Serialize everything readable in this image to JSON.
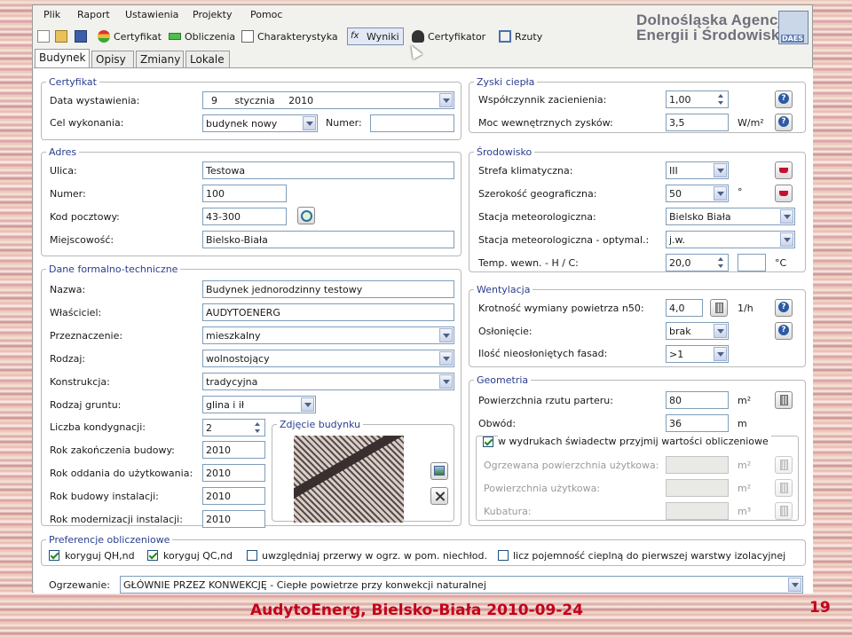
{
  "menu": [
    "Plik",
    "Raport",
    "Ustawienia",
    "Projekty",
    "Pomoc"
  ],
  "toolbar": {
    "certyfikat": "Certyfikat",
    "obliczenia": "Obliczenia",
    "charakterystyka": "Charakterystyka",
    "wyniki": "Wyniki",
    "certyfikator": "Certyfikator",
    "rzuty": "Rzuty"
  },
  "logo": {
    "line1": "Dolnośląska Agencja",
    "line2": "Energii i Środowiska",
    "mark": "DAES"
  },
  "tabs": [
    "Budynek",
    "Opisy",
    "Zmiany",
    "Lokale"
  ],
  "certyfikat": {
    "legend": "Certyfikat",
    "data_label": "Data wystawienia:",
    "data_day": "9",
    "data_month": "stycznia",
    "data_year": "2010",
    "cel_label": "Cel wykonania:",
    "cel_value": "budynek nowy",
    "numer_label": "Numer:",
    "numer_value": ""
  },
  "adres": {
    "legend": "Adres",
    "ulica_label": "Ulica:",
    "ulica": "Testowa",
    "numer_label": "Numer:",
    "numer": "100",
    "kod_label": "Kod pocztowy:",
    "kod": "43-300",
    "miejscowosc_label": "Miejscowość:",
    "miejscowosc": "Bielsko-Biała"
  },
  "dane": {
    "legend": "Dane formalno-techniczne",
    "nazwa_label": "Nazwa:",
    "nazwa": "Budynek jednorodzinny testowy",
    "wlasciciel_label": "Właściciel:",
    "wlasciciel": "AUDYTOENERG",
    "przeznaczenie_label": "Przeznaczenie:",
    "przeznaczenie": "mieszkalny",
    "rodzaj_label": "Rodzaj:",
    "rodzaj": "wolnostojący",
    "konstrukcja_label": "Konstrukcja:",
    "konstrukcja": "tradycyjna",
    "grunt_label": "Rodzaj gruntu:",
    "grunt": "glina i ił",
    "kondygnacje_label": "Liczba kondygnacji:",
    "kondygnacje": "2",
    "rok_zakonczenia_label": "Rok zakończenia budowy:",
    "rok_zakonczenia": "2010",
    "rok_oddania_label": "Rok oddania do użytkowania:",
    "rok_oddania": "2010",
    "rok_instalacji_label": "Rok budowy instalacji:",
    "rok_instalacji": "2010",
    "rok_modernizacji_label": "Rok modernizacji instalacji:",
    "rok_modernizacji": "2010",
    "zdjecie_legend": "Zdjęcie budynku"
  },
  "zyski": {
    "legend": "Zyski ciepła",
    "zacienienie_label": "Współczynnik zacienienia:",
    "zacienienie": "1,00",
    "moc_label": "Moc wewnętrznych zysków:",
    "moc": "3,5",
    "moc_unit": "W/m²"
  },
  "srodowisko": {
    "legend": "Środowisko",
    "strefa_label": "Strefa klimatyczna:",
    "strefa": "III",
    "szerokosc_label": "Szerokość geograficzna:",
    "szerokosc": "50",
    "szerokosc_unit": "°",
    "stacja_label": "Stacja meteorologiczna:",
    "stacja": "Bielsko Biała",
    "stacja_opt_label": "Stacja meteorologiczna - optymal.:",
    "stacja_opt": "j.w.",
    "temp_label": "Temp. wewn. - H / C:",
    "temp_h": "20,0",
    "temp_c": "",
    "temp_unit": "°C"
  },
  "wentylacja": {
    "legend": "Wentylacja",
    "krotnosc_label": "Krotność wymiany powietrza n50:",
    "krotnosc": "4,0",
    "krotnosc_unit": "1/h",
    "oslonienie_label": "Osłonięcie:",
    "oslonienie": "brak",
    "fasady_label": "Ilość nieosłoniętych fasad:",
    "fasady": ">1"
  },
  "geometria": {
    "legend": "Geometria",
    "powierzchnia_label": "Powierzchnia rzutu parteru:",
    "powierzchnia": "80",
    "powierzchnia_unit": "m²",
    "obwod_label": "Obwód:",
    "obwod": "36",
    "obwod_unit": "m",
    "wydruki_label": "w wydrukach świadectw przyjmij wartości obliczeniowe",
    "ogrzewana_label": "Ogrzewana powierzchnia użytkowa:",
    "ogrzewana_unit": "m²",
    "uzytkowa_label": "Powierzchnia użytkowa:",
    "uzytkowa_unit": "m²",
    "kubatura_label": "Kubatura:",
    "kubatura_unit": "m³"
  },
  "preferencje": {
    "legend": "Preferencje obliczeniowe",
    "opt1": "koryguj QH,nd",
    "opt2": "koryguj QC,nd",
    "opt3": "uwzględniaj przerwy w ogrz. w pom. niechłod.",
    "opt4": "licz pojemność cieplną do pierwszej warstwy izolacyjnej"
  },
  "ogrzewanie": {
    "label": "Ogrzewanie:",
    "value": "GŁÓWNIE PRZEZ KONWEKCJĘ - Ciepłe powietrze przy konwekcji naturalnej"
  },
  "footer": {
    "text": "AudytoEnerg, Bielsko-Biała 2010-09-24",
    "page": "19"
  }
}
